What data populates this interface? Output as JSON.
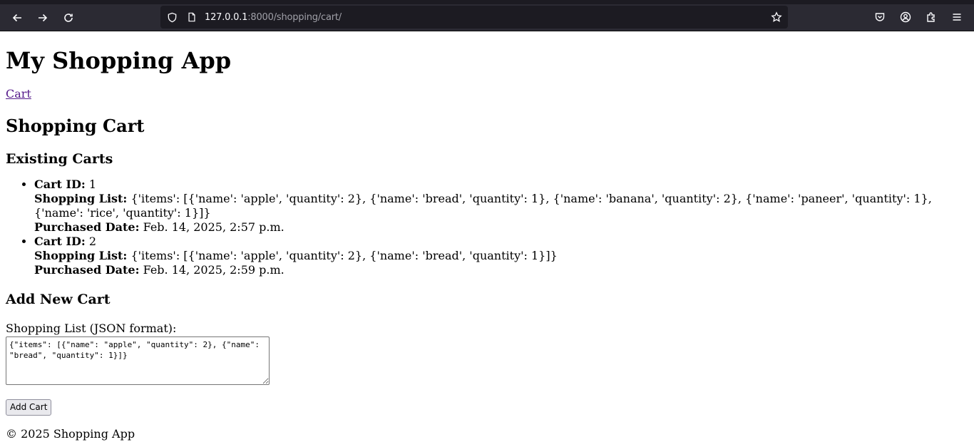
{
  "browser": {
    "url_host": "127.0.0.1",
    "url_path": ":8000/shopping/cart/",
    "icons": [
      "back-icon",
      "forward-icon",
      "reload-icon",
      "shield-icon",
      "page-icon",
      "star-icon",
      "pocket-icon",
      "account-icon",
      "extensions-icon",
      "menu-icon"
    ]
  },
  "header": {
    "title": "My Shopping App",
    "nav_cart": "Cart"
  },
  "main": {
    "page_title": "Shopping Cart",
    "existing_heading": "Existing Carts",
    "labels": {
      "cart_id": "Cart ID:",
      "shopping_list": "Shopping List:",
      "purchased_date": "Purchased Date:"
    },
    "carts": [
      {
        "id": "1",
        "list_line1": "{'items': [{'name': 'apple', 'quantity': 2}, {'name': 'bread', 'quantity': 1}, {'name': 'banana', 'quantity': 2}, {'name': 'paneer', 'quantity': 1},",
        "list_line2": "{'name': 'rice', 'quantity': 1}]}",
        "date": "Feb. 14, 2025, 2:57 p.m."
      },
      {
        "id": "2",
        "list_line1": "{'items': [{'name': 'apple', 'quantity': 2}, {'name': 'bread', 'quantity': 1}]}",
        "date": "Feb. 14, 2025, 2:59 p.m."
      }
    ],
    "add_heading": "Add New Cart",
    "form_label": "Shopping List (JSON format):",
    "textarea_value": "{\"items\": [{\"name\": \"apple\", \"quantity\": 2}, {\"name\": \"bread\", \"quantity\": 1}]}",
    "submit_label": "Add Cart"
  },
  "footer": {
    "text": "© 2025 Shopping App"
  }
}
